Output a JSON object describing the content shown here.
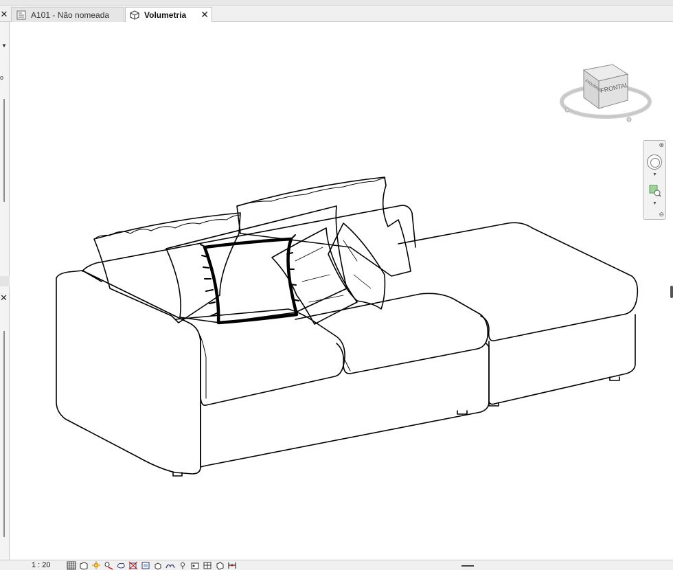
{
  "tabs": [
    {
      "label": "A101 - Não nomeada",
      "icon": "sheet-icon",
      "active": false
    },
    {
      "label": "Volumetria",
      "icon": "3d-view-icon",
      "active": true
    }
  ],
  "viewcube": {
    "face_label": "FRONTAL",
    "side_label": "ESQUERDA"
  },
  "status": {
    "scale": "1 : 20"
  },
  "colors": {
    "line": "#000000",
    "background": "#ffffff",
    "chrome": "#f0f0f0"
  }
}
